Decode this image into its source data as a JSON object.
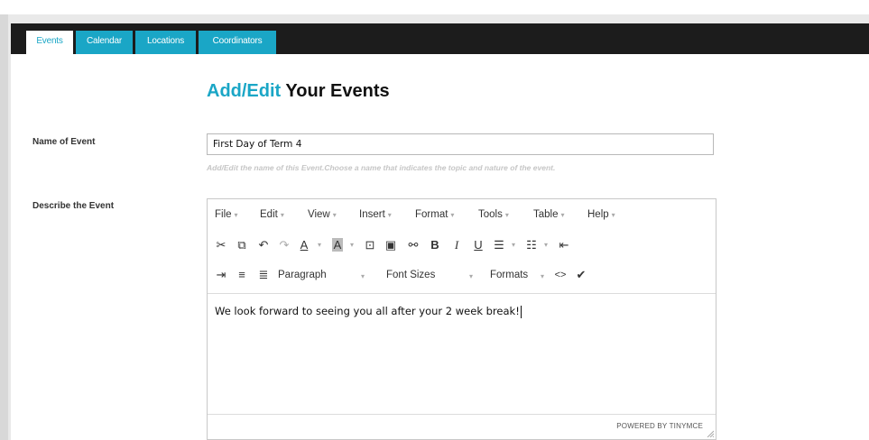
{
  "tabs": [
    {
      "label": "Events",
      "active": true
    },
    {
      "label": "Calendar",
      "active": false
    },
    {
      "label": "Locations",
      "active": false
    },
    {
      "label": "Coordinators",
      "active": false
    }
  ],
  "heading": {
    "accent": "Add/Edit",
    "rest": " Your Events"
  },
  "form": {
    "name_label": "Name of Event",
    "name_value": "First Day of Term 4",
    "name_hint": "Add/Edit the name of this Event.Choose a name that indicates the topic and nature of the event.",
    "describe_label": "Describe the Event"
  },
  "editor": {
    "menus": [
      "File",
      "Edit",
      "View",
      "Insert",
      "Format",
      "Tools",
      "Table",
      "Help"
    ],
    "paragraph": "Paragraph",
    "font_sizes": "Font Sizes",
    "formats": "Formats",
    "content": "We look forward to seeing you all after your 2 week break!",
    "powered_by": "POWERED BY TINYMCE"
  },
  "icons": [
    "cut-icon",
    "copy-icon",
    "undo-icon",
    "redo-icon",
    "text-color-icon",
    "background-color-icon",
    "media-icon",
    "image-icon",
    "link-icon",
    "bold-icon",
    "italic-icon",
    "underline-icon",
    "bullet-list-icon",
    "numbered-list-icon",
    "outdent-icon",
    "indent-icon",
    "align-left-icon",
    "align-center-icon",
    "code-icon",
    "spellcheck-icon"
  ],
  "colors": {
    "accent": "#1aa6c6",
    "tabbar": "#1c1c1c"
  }
}
